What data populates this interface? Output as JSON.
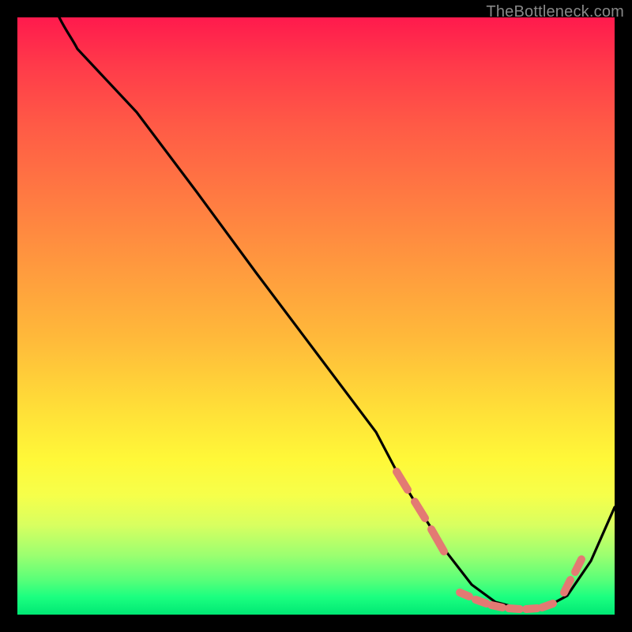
{
  "watermark": "TheBottleneck.com",
  "chart_data": {
    "type": "line",
    "title": "",
    "xlabel": "",
    "ylabel": "",
    "xlim": [
      0,
      100
    ],
    "ylim": [
      0,
      100
    ],
    "grid": false,
    "series": [
      {
        "name": "curve",
        "x": [
          7,
          10,
          20,
          30,
          40,
          50,
          60,
          64,
          68,
          72,
          76,
          80,
          84,
          88,
          92,
          96,
          100
        ],
        "y": [
          100,
          97,
          84,
          70,
          57,
          44,
          30,
          23,
          16,
          10,
          5,
          2,
          1,
          1,
          3,
          9,
          18
        ]
      }
    ],
    "markers": {
      "color": "#e57373",
      "segments": [
        {
          "x": [
            63,
            72
          ],
          "y": [
            23.5,
            9
          ]
        },
        {
          "x": [
            74,
            92
          ],
          "y": [
            3.5,
            1.5
          ]
        },
        {
          "x": [
            88,
            92
          ],
          "y": [
            3.5,
            7.5
          ]
        }
      ]
    },
    "background_gradient": {
      "top": "#ff1a4d",
      "mid": "#ffe038",
      "bottom": "#00e874"
    }
  }
}
